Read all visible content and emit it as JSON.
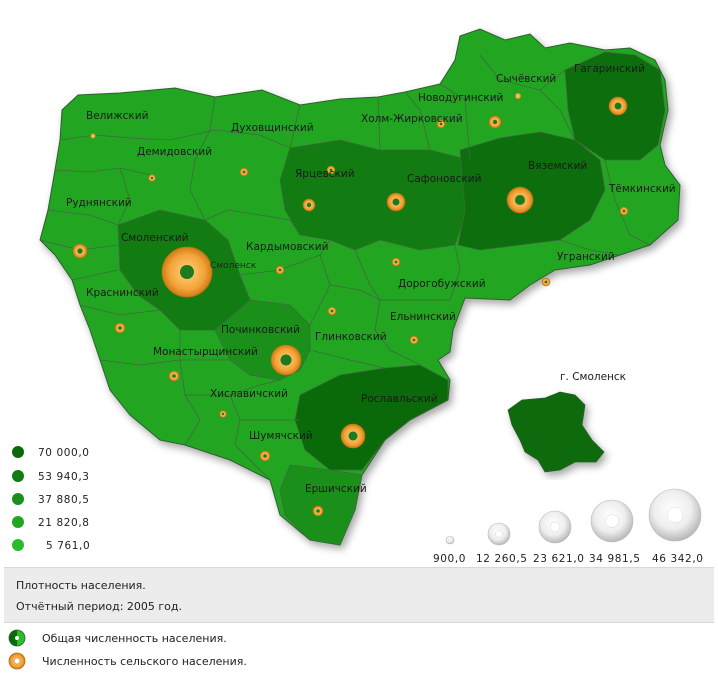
{
  "colors": {
    "level1": "#0a6a0a",
    "level2": "#127c12",
    "level3": "#1a8f1a",
    "level4": "#22a622",
    "level5": "#2bbb2b",
    "ring": "#f0a030",
    "border": "#3f6a3f"
  },
  "districts": [
    {
      "name": "Велижский"
    },
    {
      "name": "Демидовский"
    },
    {
      "name": "Духовщинский"
    },
    {
      "name": "Холм-Жирковский"
    },
    {
      "name": "Новодугинский"
    },
    {
      "name": "Сычёвский"
    },
    {
      "name": "Гагаринский"
    },
    {
      "name": "Руднянский"
    },
    {
      "name": "Ярцевский"
    },
    {
      "name": "Сафоновский"
    },
    {
      "name": "Вяземский"
    },
    {
      "name": "Тёмкинский"
    },
    {
      "name": "Смоленский"
    },
    {
      "name": "Кардымовский"
    },
    {
      "name": "Угранский"
    },
    {
      "name": "Краснинский"
    },
    {
      "name": "Дорогобужский"
    },
    {
      "name": "Починковский"
    },
    {
      "name": "Глинковский"
    },
    {
      "name": "Ельнинский"
    },
    {
      "name": "Монастырщинский"
    },
    {
      "name": "Хиславичский"
    },
    {
      "name": "Рославльский"
    },
    {
      "name": "Шумячский"
    },
    {
      "name": "Ершичский"
    }
  ],
  "city_label": "Смоленск",
  "inset_label": "г. Смоленск",
  "density_legend": [
    "70 000,0",
    "53 940,3",
    "37 880,5",
    "21 820,8",
    "5 761,0"
  ],
  "ring_legend": [
    "900,0",
    "12 260,5",
    "23 621,0",
    "34 981,5",
    "46 342,0"
  ],
  "info": {
    "title": "Плотность населения.",
    "period": "Отчётный период: 2005 год."
  },
  "key": {
    "total": "Общая численность населения.",
    "rural": "Численность сельского населения."
  }
}
